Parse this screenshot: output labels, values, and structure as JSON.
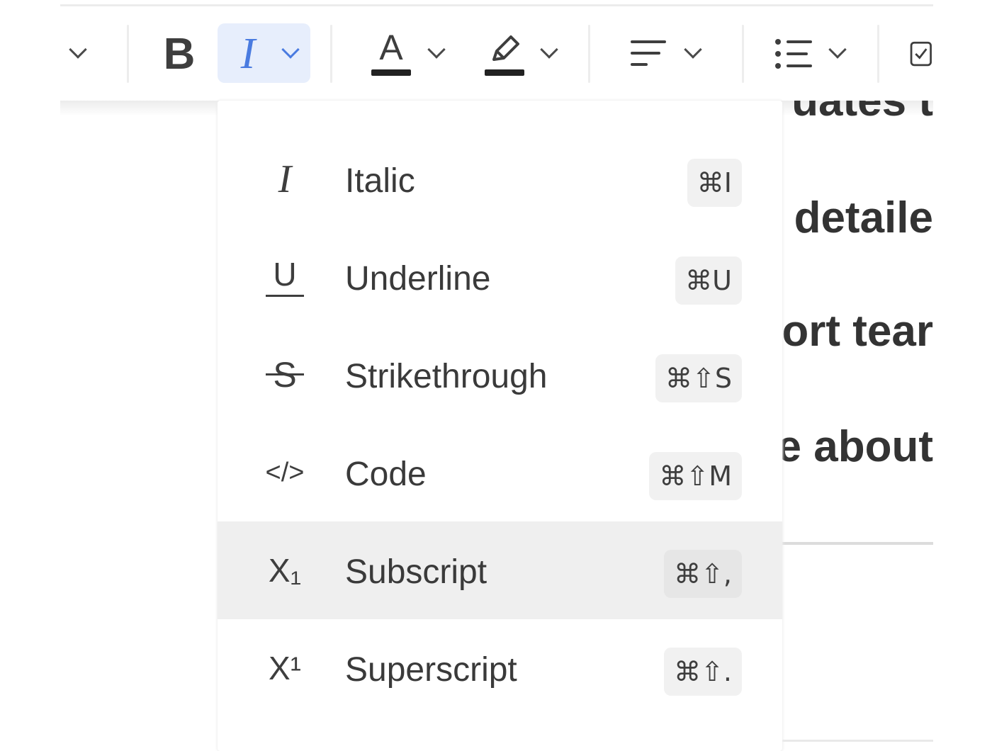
{
  "toolbar": {
    "bold_glyph": "B",
    "italic_glyph": "I",
    "text_color_glyph": "A"
  },
  "document": {
    "lines": [
      "uates t",
      "detaile",
      "ort tear",
      "e about"
    ]
  },
  "format_menu": {
    "items": [
      {
        "label": "Italic",
        "icon": "italic-icon",
        "icon_text": "I",
        "shortcut": "⌘I"
      },
      {
        "label": "Underline",
        "icon": "underline-icon",
        "icon_text": "U",
        "shortcut": "⌘U"
      },
      {
        "label": "Strikethrough",
        "icon": "strikethrough-icon",
        "icon_text": "S",
        "shortcut": "⌘⇧S"
      },
      {
        "label": "Code",
        "icon": "code-icon",
        "icon_text": "</>",
        "shortcut": "⌘⇧M"
      },
      {
        "label": "Subscript",
        "icon": "subscript-icon",
        "icon_text": "X₁",
        "shortcut": "⌘⇧,",
        "highlighted": true
      },
      {
        "label": "Superscript",
        "icon": "superscript-icon",
        "icon_text": "X¹",
        "shortcut": "⌘⇧."
      }
    ]
  },
  "colors": {
    "active_bg": "#e7eefc",
    "active_icon": "#4a7be0",
    "hover_bg": "#efefef",
    "kbd_bg": "#f1f1f1"
  }
}
